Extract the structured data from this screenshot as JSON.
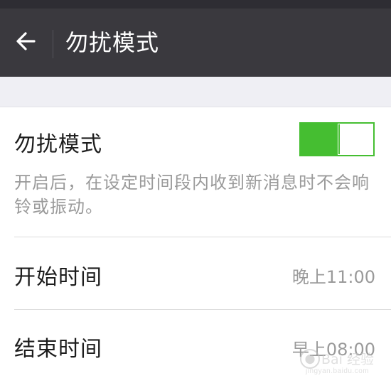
{
  "header": {
    "title": "勿扰模式",
    "back_icon": "arrow-left-icon",
    "background": "#3a393e"
  },
  "dnd": {
    "label": "勿扰模式",
    "enabled": true,
    "accent_color": "#45be31",
    "description": "开启后，在设定时间段内收到新消息时不会响铃或振动。"
  },
  "schedule": {
    "start": {
      "label": "开始时间",
      "value": "晚上11:00"
    },
    "end": {
      "label": "结束时间",
      "value": "早上08:00"
    }
  },
  "watermark": {
    "icon": "baidu-paw-icon",
    "text": "Bai 经验",
    "url": "jingyan.baidu.com"
  }
}
